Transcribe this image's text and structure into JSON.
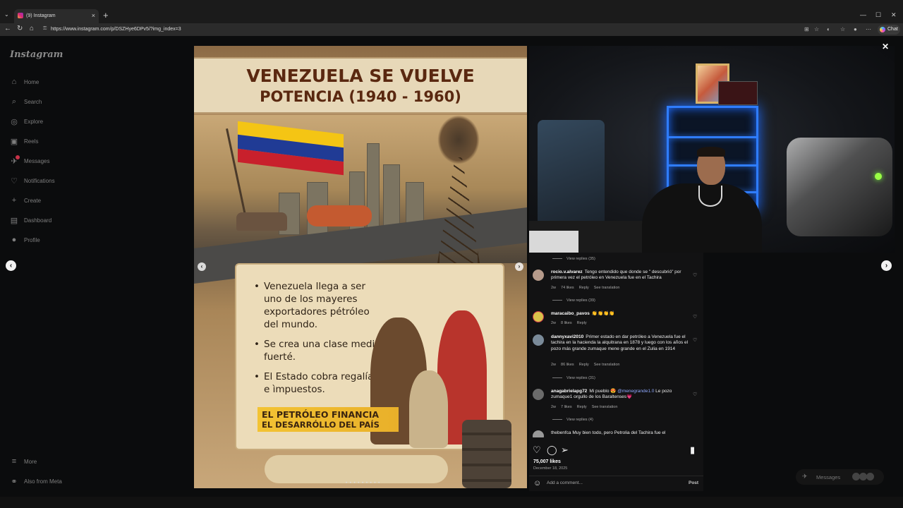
{
  "browser": {
    "tab_title": "(9) Instagram",
    "tab_close": "×",
    "new_tab": "+",
    "url": "https://www.instagram.com/p/DSZHye6DPv5/?img_index=3",
    "chat_label": "Chat"
  },
  "sidebar": {
    "logo": "Instagram",
    "items": [
      {
        "label": "Home",
        "icon": "home-icon",
        "glyph": "⌂"
      },
      {
        "label": "Search",
        "icon": "search-icon",
        "glyph": "⌕"
      },
      {
        "label": "Explore",
        "icon": "explore-icon",
        "glyph": "◎"
      },
      {
        "label": "Reels",
        "icon": "reels-icon",
        "glyph": "▣"
      },
      {
        "label": "Messages",
        "icon": "messages-icon",
        "glyph": "✈"
      },
      {
        "label": "Notifications",
        "icon": "heart-icon",
        "glyph": "♡"
      },
      {
        "label": "Create",
        "icon": "plus-icon",
        "glyph": "+"
      },
      {
        "label": "Dashboard",
        "icon": "dashboard-icon",
        "glyph": "▤"
      },
      {
        "label": "Profile",
        "icon": "avatar-icon",
        "glyph": "●"
      }
    ],
    "more": "More",
    "also_from_meta": "Also from Meta"
  },
  "post_image": {
    "title_line1": "VENEZUELA SE VUELVE",
    "title_line2": "POTENCIA (1940 - 1960)",
    "bullets": [
      "Venezuela llega a ser uno de los mayeres exportadores pétróleo del mundo.",
      "Se crea una clase media fuerté.",
      "El Estado cobra regalías e ìmpuestos."
    ],
    "cta_line1": "EL PETRÓLEO FINANCIA",
    "cta_line2": "EL DESARRÓLLO DEL PAÍS",
    "carousel_dots": "• • • • • • • • •"
  },
  "comments": {
    "top_view_replies": "View replies (35)",
    "items": [
      {
        "user": "rocio.v.alvarez",
        "text": "Tengo entendido que donde se \" descubrió\" por primera vez el petróleo en Venezuela fue en el Tachira",
        "age": "2w",
        "likes": "74 likes",
        "reply": "Reply",
        "translate": "See translation",
        "view_replies": "View replies (39)"
      },
      {
        "user": "maracaibo_pavos",
        "text": "👏👏👏👏",
        "age": "2w",
        "likes": "8 likes",
        "reply": "Reply"
      },
      {
        "user": "dannyxavi2010",
        "text": "Primer estado en dar petróleo a Venezuela fue el tachira en la hacienda la alquitrana en 1878 y luego con los años el pozo más grande zumaque mene grande en el Zulia en 1914",
        "age": "2w",
        "likes": "86 likes",
        "reply": "Reply",
        "translate": "See translation",
        "view_replies": "View replies (31)"
      },
      {
        "user": "anagabrielapg72",
        "text_pre": "Mi pueblo 😍",
        "mention": "@menegrande1.0",
        "text_post": "Le pozo zumaque1 orgullo de los Baraltenses💗",
        "age": "2w",
        "likes": "7 likes",
        "reply": "Reply",
        "translate": "See translation",
        "view_replies": "View replies (4)"
      }
    ],
    "partial_next": "thebenfca Muy bien todo, pero Petrolia del Tachira fue el"
  },
  "post_footer": {
    "likes": "75,007 likes",
    "date": "December 18, 2025",
    "add_comment_placeholder": "Add a comment...",
    "post_button": "Post"
  },
  "messages_pill": {
    "label": "Messages"
  },
  "colors": {
    "background": "#0b0c0d",
    "panel": "#121213",
    "mention": "#8fa9ff",
    "led_blue": "#2f7dff"
  }
}
